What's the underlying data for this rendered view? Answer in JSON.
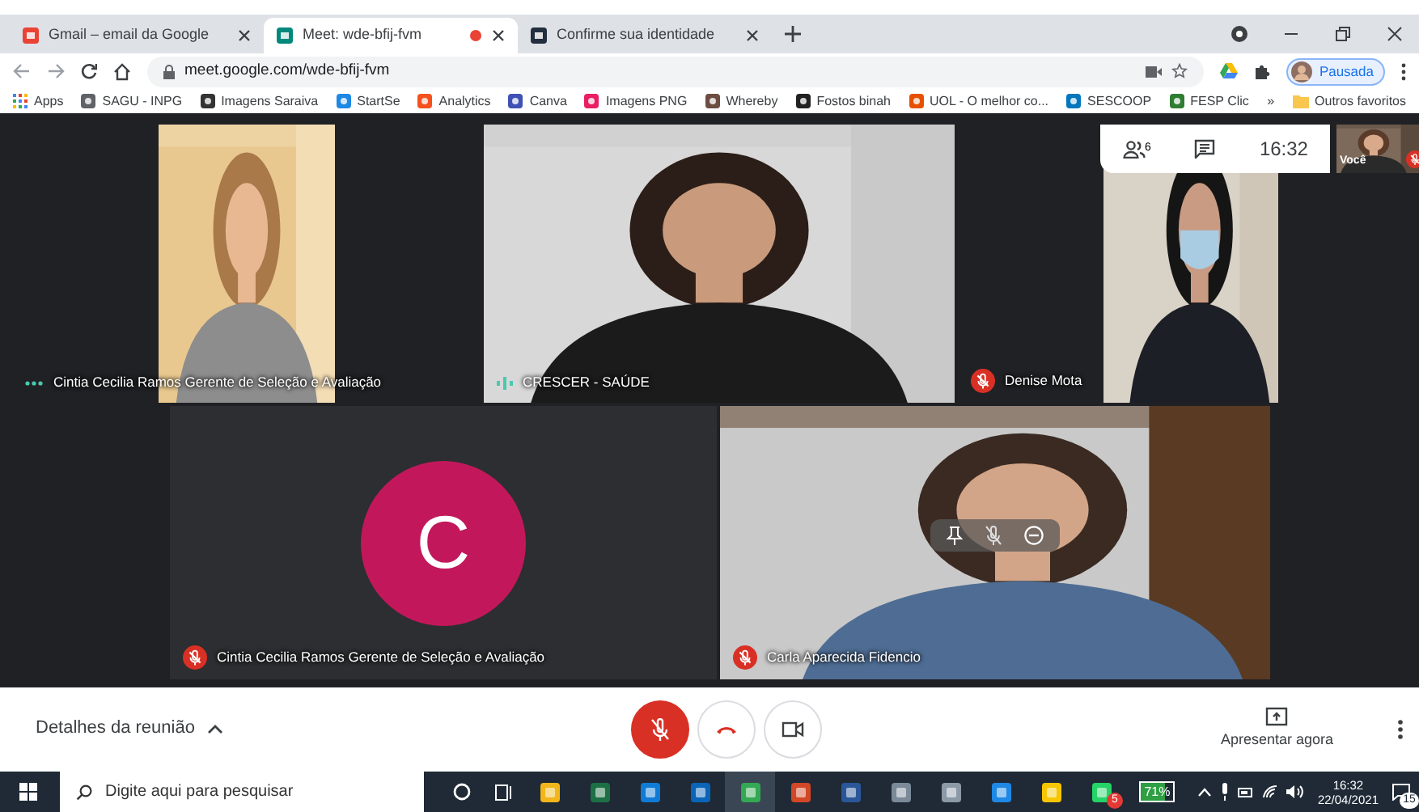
{
  "browser": {
    "tabs": [
      {
        "title": "Gmail – email da Google",
        "selected": false,
        "recording": false,
        "color": "#ea4335"
      },
      {
        "title": "Meet: wde-bfij-fvm",
        "selected": true,
        "recording": true,
        "color": "#00897b"
      },
      {
        "title": "Confirme sua identidade",
        "selected": false,
        "recording": false,
        "color": "#232f3e"
      }
    ],
    "address": "meet.google.com/wde-bfij-fvm",
    "profile": "Pausada",
    "bookmarks": [
      {
        "label": "Apps",
        "color": "#4285f4"
      },
      {
        "label": "SAGU - INPG",
        "color": "#5f6368"
      },
      {
        "label": "Imagens Saraiva",
        "color": "#333333"
      },
      {
        "label": "StartSe",
        "color": "#1e88e5"
      },
      {
        "label": "Analytics",
        "color": "#f4511e"
      },
      {
        "label": "Canva",
        "color": "#3f51b5"
      },
      {
        "label": "Imagens PNG",
        "color": "#e91e63"
      },
      {
        "label": "Whereby",
        "color": "#6d4c41"
      },
      {
        "label": "Fostos binah",
        "color": "#212121"
      },
      {
        "label": "UOL - O melhor co...",
        "color": "#e65100"
      },
      {
        "label": "SESCOOP",
        "color": "#0277bd"
      },
      {
        "label": "FESP Clic",
        "color": "#2e7d32"
      }
    ],
    "overflow": "»",
    "other_bookmarks": "Outros favoritos"
  },
  "meet": {
    "tiles": [
      {
        "kind": "video",
        "name": "Cintia Cecilia Ramos Gerente de Seleção e Avaliação",
        "muted": false,
        "speaking": false
      },
      {
        "kind": "video",
        "name": "CRESCER - SAÚDE",
        "muted": false,
        "speaking": true
      },
      {
        "kind": "video",
        "name": "Denise Mota",
        "muted": true
      },
      {
        "kind": "avatar",
        "name": "Cintia Cecilia Ramos Gerente de Seleção e Avaliação",
        "muted": true,
        "initial": "C",
        "color": "#c2185b"
      },
      {
        "kind": "video",
        "name": "Carla Aparecida Fidencio",
        "muted": true,
        "controls_shown": true
      }
    ],
    "panel": {
      "participants": "6",
      "time": "16:32"
    },
    "self_view": {
      "label": "Você",
      "muted": true
    },
    "details": {
      "label": "Detalhes da reunião",
      "expanded": false
    },
    "mic_muted": true,
    "camera_off": false,
    "present": "Apresentar agora"
  },
  "taskbar": {
    "search_placeholder": "Digite aqui para pesquisar",
    "apps": [
      {
        "color": "#f2b61b",
        "active": false
      },
      {
        "color": "#1d7044",
        "active": false
      },
      {
        "color": "#0f7bd6",
        "active": false
      },
      {
        "color": "#0a64b8",
        "active": false
      },
      {
        "color": "#34a853",
        "active": true
      },
      {
        "color": "#d24726",
        "active": false
      },
      {
        "color": "#2b579a",
        "active": false
      },
      {
        "color": "#7a8a99",
        "active": false
      },
      {
        "color": "#8c9aa8",
        "active": false
      },
      {
        "color": "#1e88e5",
        "active": false
      },
      {
        "color": "#f7c600",
        "active": false
      },
      {
        "color": "#25d366",
        "active": false,
        "badge": "5"
      }
    ],
    "battery": {
      "reading": "71%",
      "level": 0.71
    },
    "time": "16:32",
    "date": "22/04/2021",
    "notifications": "15"
  }
}
